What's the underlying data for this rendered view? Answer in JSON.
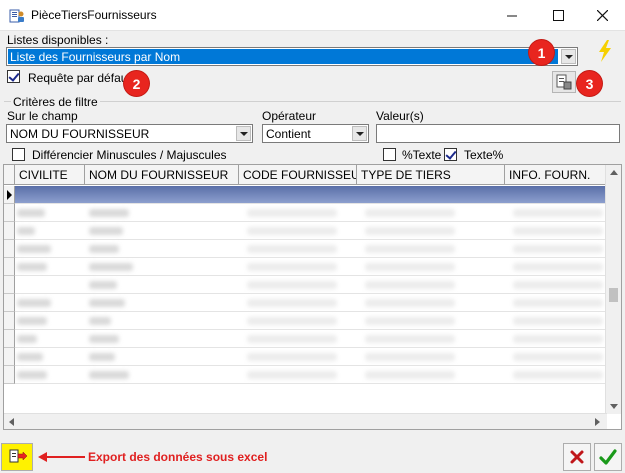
{
  "window": {
    "title": "PièceTiersFournisseurs",
    "minimize_icon": "minimize-icon",
    "maximize_icon": "maximize-icon",
    "close_icon": "close-icon"
  },
  "lists": {
    "label": "Listes disponibles :",
    "selected": "Liste des Fournisseurs par Nom",
    "default_query_label": "Requête par défaut",
    "default_query_checked": true
  },
  "filter": {
    "group_label": "Critères de filtre",
    "field_label": "Sur le champ",
    "field_value": "NOM DU FOURNISSEUR",
    "operator_label": "Opérateur",
    "operator_value": "Contient",
    "value_label": "Valeur(s)",
    "value_text": "",
    "case_label": "Différencier Minuscules / Majuscules",
    "case_checked": false,
    "pct_text_label": "%Texte",
    "pct_text_checked": false,
    "text_pct_label": "Texte%",
    "text_pct_checked": true
  },
  "badges": [
    "1",
    "2",
    "3"
  ],
  "grid": {
    "columns": [
      "CIVILITE",
      "NOM DU FOURNISSEUR",
      "CODE FOURNISSEUR",
      "TYPE DE TIERS",
      "INFO. FOURN."
    ],
    "row_count": 11
  },
  "footer": {
    "export_label": "Export des données sous excel",
    "cancel_icon": "cancel-x-icon",
    "ok_icon": "ok-check-icon"
  },
  "colors": {
    "selection": "#0078d7",
    "badge": "#e8251f",
    "export_text": "#e02020",
    "export_button": "#fff200",
    "ok_green": "#1a9a1a",
    "cancel_red": "#c0161a"
  }
}
